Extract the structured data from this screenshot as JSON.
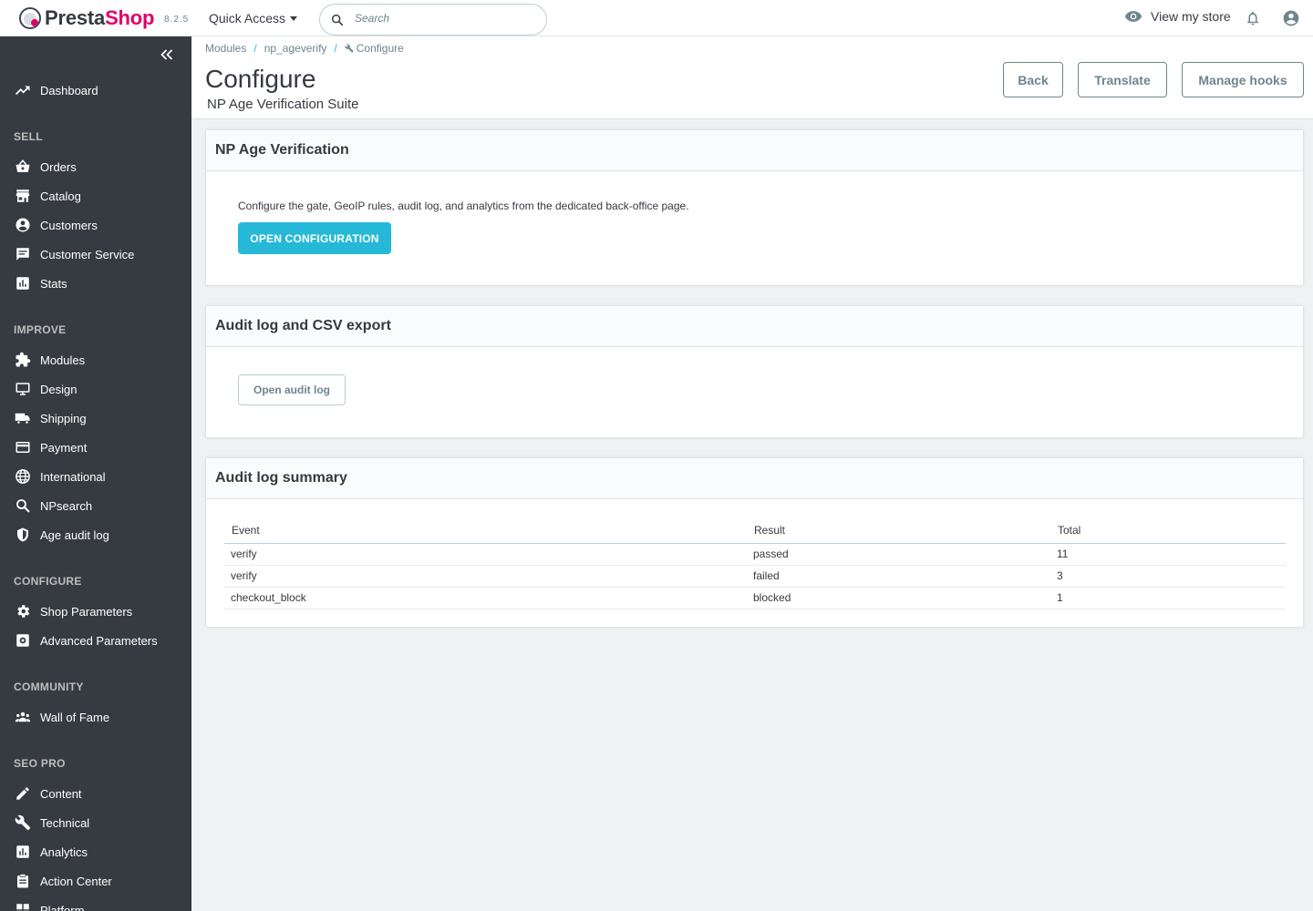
{
  "header": {
    "logo_text_part1": "Presta",
    "logo_text_part2": "Shop",
    "version": "8.2.5",
    "quick_access_label": "Quick Access",
    "search_placeholder": "Search",
    "view_store_label": "View my store"
  },
  "sidebar": {
    "items": [
      {
        "label": "Dashboard",
        "icon": "trending-up-icon"
      },
      {
        "section": "SELL"
      },
      {
        "label": "Orders",
        "icon": "shopping-basket-icon"
      },
      {
        "label": "Catalog",
        "icon": "store-icon"
      },
      {
        "label": "Customers",
        "icon": "account-circle-icon"
      },
      {
        "label": "Customer Service",
        "icon": "chat-icon"
      },
      {
        "label": "Stats",
        "icon": "assessment-icon"
      },
      {
        "section": "IMPROVE"
      },
      {
        "label": "Modules",
        "icon": "extension-icon"
      },
      {
        "label": "Design",
        "icon": "desktop-icon"
      },
      {
        "label": "Shipping",
        "icon": "truck-icon"
      },
      {
        "label": "Payment",
        "icon": "credit-card-icon"
      },
      {
        "label": "International",
        "icon": "globe-icon"
      },
      {
        "label": "NPsearch",
        "icon": "search-icon"
      },
      {
        "label": "Age audit log",
        "icon": "shield-icon"
      },
      {
        "section": "CONFIGURE"
      },
      {
        "label": "Shop Parameters",
        "icon": "gear-icon"
      },
      {
        "label": "Advanced Parameters",
        "icon": "settings-applications-icon"
      },
      {
        "section": "COMMUNITY"
      },
      {
        "label": "Wall of Fame",
        "icon": "people-icon"
      },
      {
        "section": "SEO PRO"
      },
      {
        "label": "Content",
        "icon": "edit-icon"
      },
      {
        "label": "Technical",
        "icon": "wrench-icon"
      },
      {
        "label": "Analytics",
        "icon": "bar-chart-icon"
      },
      {
        "label": "Action Center",
        "icon": "clipboard-icon"
      },
      {
        "label": "Platform",
        "icon": "platform-icon"
      }
    ]
  },
  "toolbar": {
    "breadcrumb": [
      "Modules",
      "np_ageverify",
      "Configure"
    ],
    "title": "Configure",
    "subtitle": "NP Age Verification Suite",
    "buttons": {
      "back": "Back",
      "translate": "Translate",
      "manage_hooks": "Manage hooks"
    }
  },
  "cards": {
    "verification": {
      "title": "NP Age Verification",
      "description": "Configure the gate, GeoIP rules, audit log, and analytics from the dedicated back-office page.",
      "button": "OPEN CONFIGURATION"
    },
    "audit_export": {
      "title": "Audit log and CSV export",
      "button": "Open audit log"
    },
    "summary": {
      "title": "Audit log summary",
      "columns": [
        "Event",
        "Result",
        "Total"
      ],
      "rows": [
        [
          "verify",
          "passed",
          "11"
        ],
        [
          "verify",
          "failed",
          "3"
        ],
        [
          "checkout_block",
          "blocked",
          "1"
        ]
      ]
    }
  },
  "colors": {
    "brand_pink": "#df0067",
    "primary": "#25b9d7",
    "sidebar_bg": "#363a41"
  }
}
